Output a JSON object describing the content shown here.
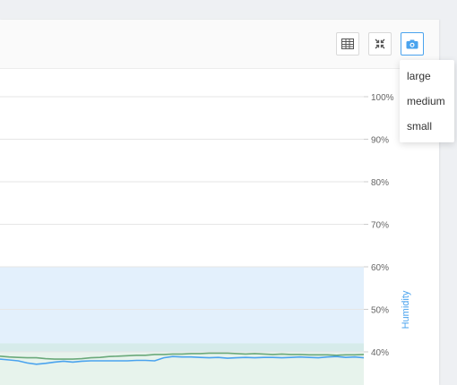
{
  "toolbar": {
    "table_icon": "table-icon",
    "fullscreen_icon": "compress-icon",
    "snapshot_icon": "camera-icon",
    "accent_color": "#4aa3ee"
  },
  "snapshot_menu": {
    "items": [
      {
        "label": "large"
      },
      {
        "label": "medium"
      },
      {
        "label": "small"
      }
    ]
  },
  "chart_data": {
    "type": "line",
    "y_axis": {
      "title": "Humidity",
      "title_color": "#4aa3ee",
      "position": "right",
      "ticks": [
        "100%",
        "90%",
        "80%",
        "70%",
        "60%",
        "50%",
        "40%"
      ],
      "visible_range": [
        35,
        100
      ]
    },
    "grid": true,
    "bands": [
      {
        "from": 40,
        "to": 60,
        "color": "#e3f0fc"
      },
      {
        "from": 0,
        "to": 40,
        "color": "#e7f3ec"
      },
      {
        "from": 40,
        "to": 42,
        "color": "#d6ebea"
      }
    ],
    "series": [
      {
        "color": "#6aa97a",
        "values": [
          39.0,
          38.8,
          38.7,
          38.6,
          38.6,
          38.4,
          38.3,
          38.3,
          38.3,
          38.4,
          38.6,
          38.7,
          38.9,
          39.0,
          39.1,
          39.2,
          39.2,
          39.4,
          39.4,
          39.5,
          39.5,
          39.6,
          39.6,
          39.7,
          39.7,
          39.7,
          39.6,
          39.5,
          39.6,
          39.5,
          39.4,
          39.5,
          39.4,
          39.4,
          39.3,
          39.3,
          39.3,
          39.2,
          39.3,
          39.3,
          39.4
        ]
      },
      {
        "color": "#4aa3ee",
        "values": [
          38.3,
          38.1,
          37.9,
          37.4,
          37.1,
          37.3,
          37.6,
          37.8,
          37.6,
          37.8,
          37.9,
          37.9,
          37.9,
          37.9,
          37.9,
          38.0,
          38.0,
          37.9,
          38.6,
          38.9,
          38.8,
          38.8,
          38.7,
          38.6,
          38.7,
          38.5,
          38.6,
          38.7,
          38.6,
          38.7,
          38.7,
          38.6,
          38.7,
          38.8,
          38.7,
          38.6,
          38.8,
          38.9,
          38.7,
          38.8,
          38.6
        ]
      }
    ]
  }
}
